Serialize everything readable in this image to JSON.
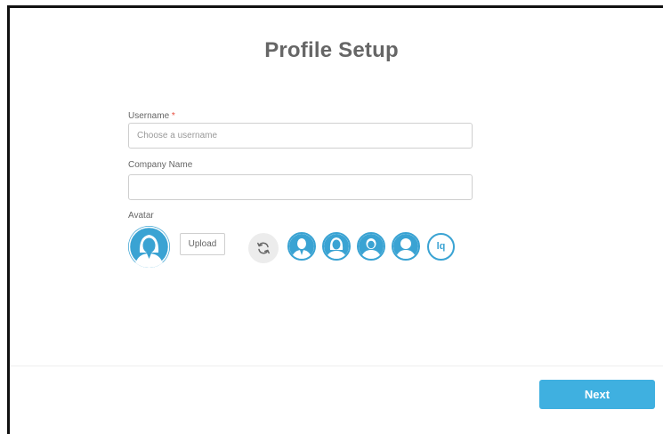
{
  "page": {
    "title": "Profile Setup"
  },
  "form": {
    "username": {
      "label": "Username",
      "required_mark": "*",
      "value": "",
      "placeholder": "Choose a username"
    },
    "company": {
      "label": "Company Name",
      "value": "",
      "placeholder": ""
    },
    "avatar": {
      "label": "Avatar",
      "upload_label": "Upload",
      "refresh_icon": "refresh-icon",
      "options": [
        {
          "icon": "avatar-man-suit-icon"
        },
        {
          "icon": "avatar-woman-icon"
        },
        {
          "icon": "avatar-man-short-hair-icon"
        },
        {
          "icon": "avatar-person-icon"
        },
        {
          "initials": "lq"
        }
      ]
    }
  },
  "footer": {
    "next_label": "Next"
  },
  "colors": {
    "accent": "#3aa3d3",
    "button": "#3fb0e0"
  }
}
